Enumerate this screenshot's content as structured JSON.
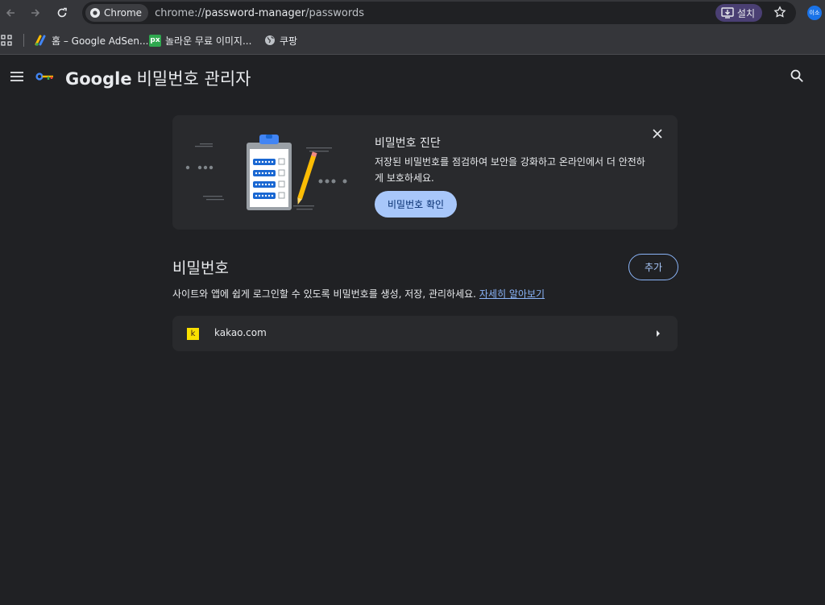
{
  "browser": {
    "chip_label": "Chrome",
    "url_scheme": "chrome://",
    "url_host": "password-manager",
    "url_path": "/passwords",
    "install_label": "설치",
    "profile_initials": "이소"
  },
  "bookmarks": [
    {
      "label": "홈 – Google AdSen...",
      "icon": "adsense-icon"
    },
    {
      "label": "놀라운 무료 이미지...",
      "icon": "pixabay-icon",
      "icon_text": "px"
    },
    {
      "label": "쿠팡",
      "icon": "globe-icon"
    }
  ],
  "header": {
    "brand": "Google",
    "title": "비밀번호 관리자"
  },
  "checkup": {
    "title": "비밀번호 진단",
    "description": "저장된 비밀번호를 점검하여 보안을 강화하고 온라인에서 더 안전하게 보호하세요.",
    "button_label": "비밀번호 확인"
  },
  "passwords": {
    "title": "비밀번호",
    "add_label": "추가",
    "description": "사이트와 앱에 쉽게 로그인할 수 있도록 비밀번호를 생성, 저장, 관리하세요.",
    "learn_more": "자세히 알아보기",
    "items": [
      {
        "site": "kakao.com",
        "favicon_text": "k"
      }
    ]
  },
  "colors": {
    "background": "#202124",
    "card": "#292a2d",
    "accent": "#a8c7fa",
    "link": "#8ab4f8"
  }
}
